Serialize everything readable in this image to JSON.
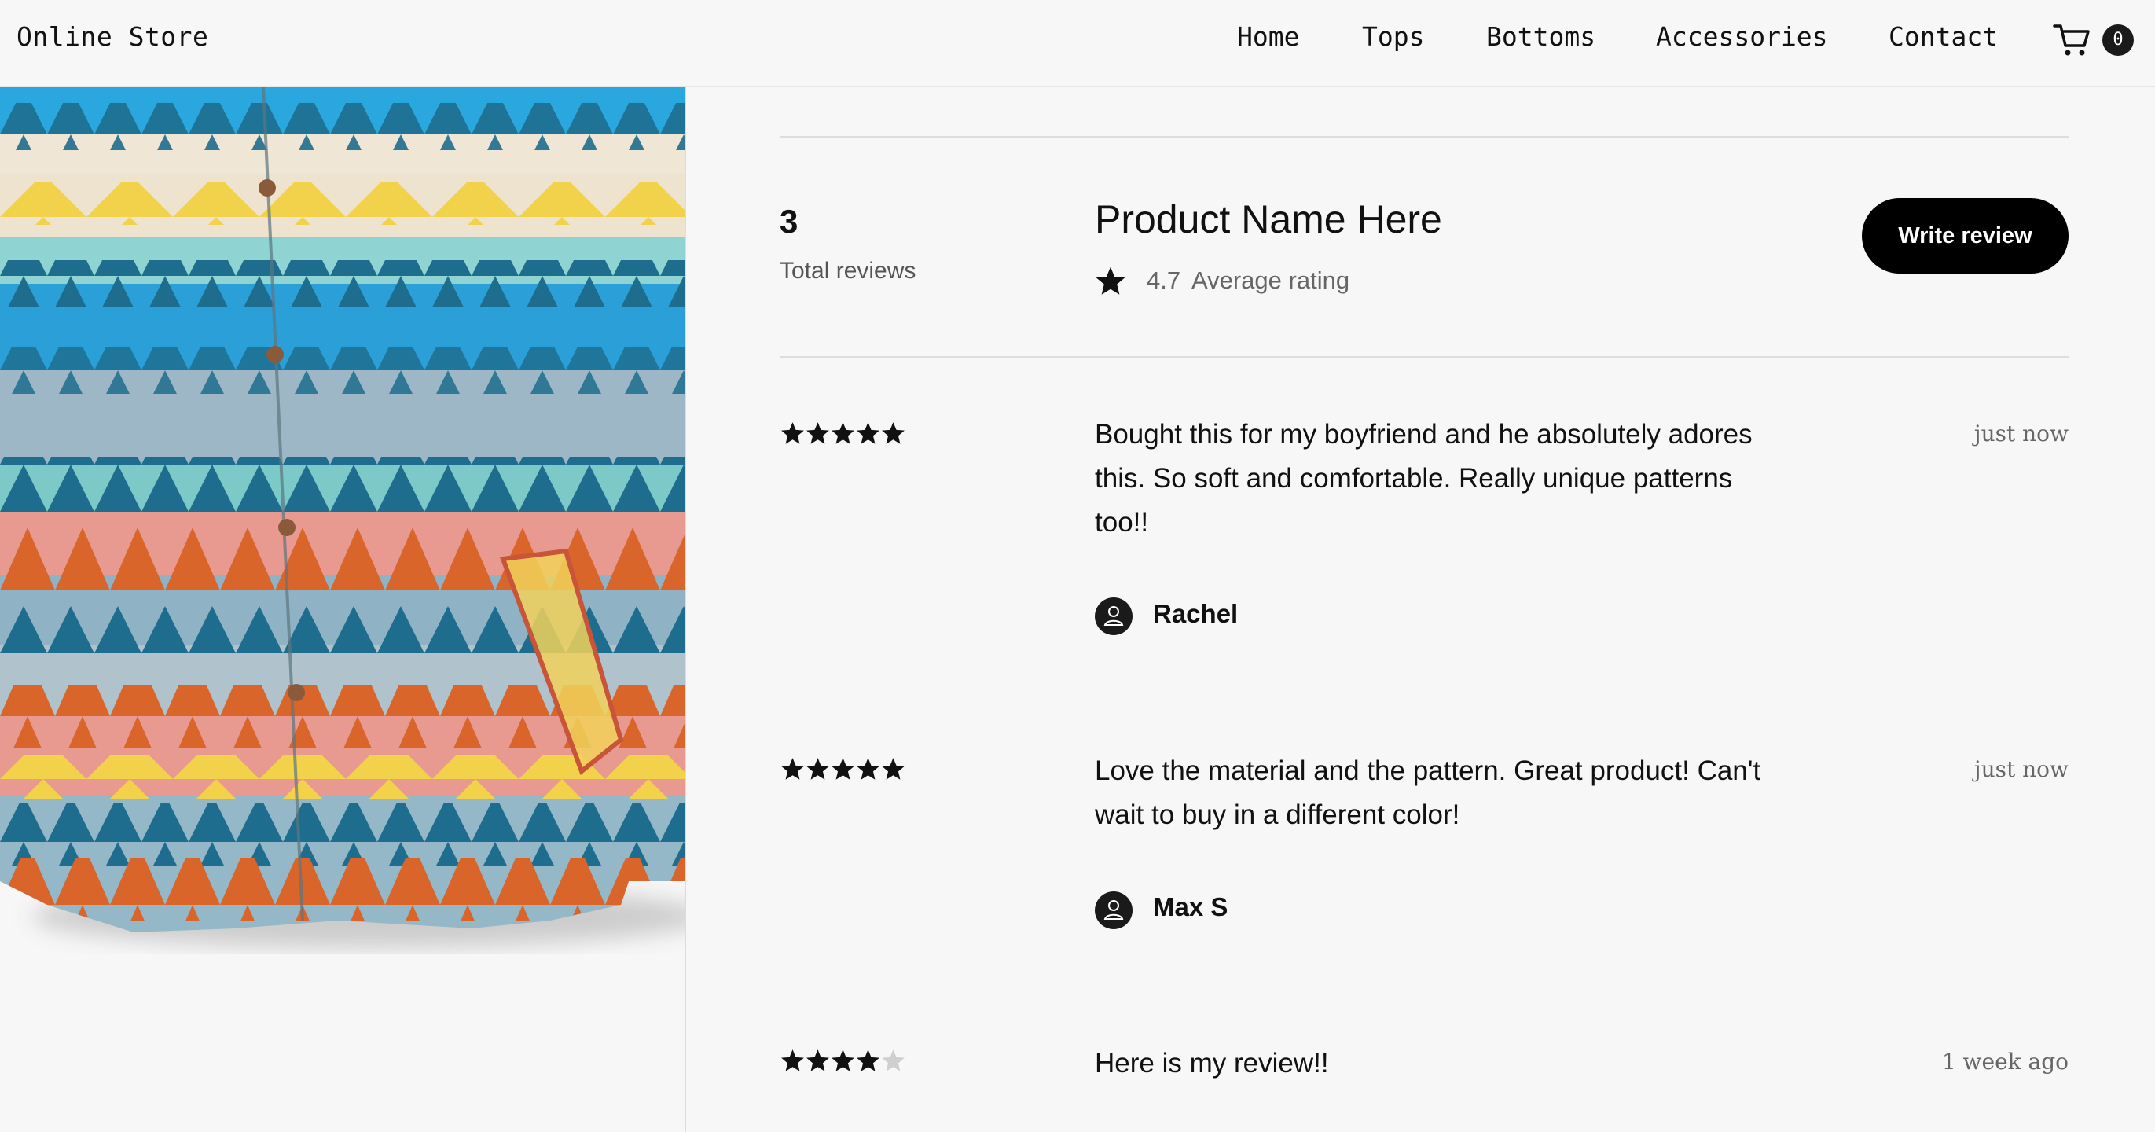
{
  "header": {
    "brand": "Online Store",
    "nav": [
      "Home",
      "Tops",
      "Bottoms",
      "Accessories",
      "Contact"
    ],
    "cart_count": "0"
  },
  "summary": {
    "total_count": "3",
    "total_label": "Total reviews",
    "product_name": "Product Name Here",
    "average_rating": "4.7",
    "average_label": "Average rating",
    "write_review_label": "Write review"
  },
  "reviews": [
    {
      "rating": 5,
      "text": "Bought this for my boyfriend and he absolutely adores this. So soft and comfortable. Really unique patterns too!!",
      "date": "just now",
      "author": "Rachel"
    },
    {
      "rating": 5,
      "text": "Love the material and the pattern. Great product! Can't wait to buy in a different color!",
      "date": "just now",
      "author": "Max S"
    },
    {
      "rating": 4,
      "text": "Here is my review!!",
      "date": "1 week ago",
      "author": ""
    }
  ],
  "colors": {
    "background": "#f7f7f7",
    "button": "#000000",
    "star_filled": "#111111",
    "star_empty": "#cfcfcf"
  },
  "icons": {
    "cart": "cart-icon",
    "star": "star-icon",
    "avatar": "user-icon"
  }
}
